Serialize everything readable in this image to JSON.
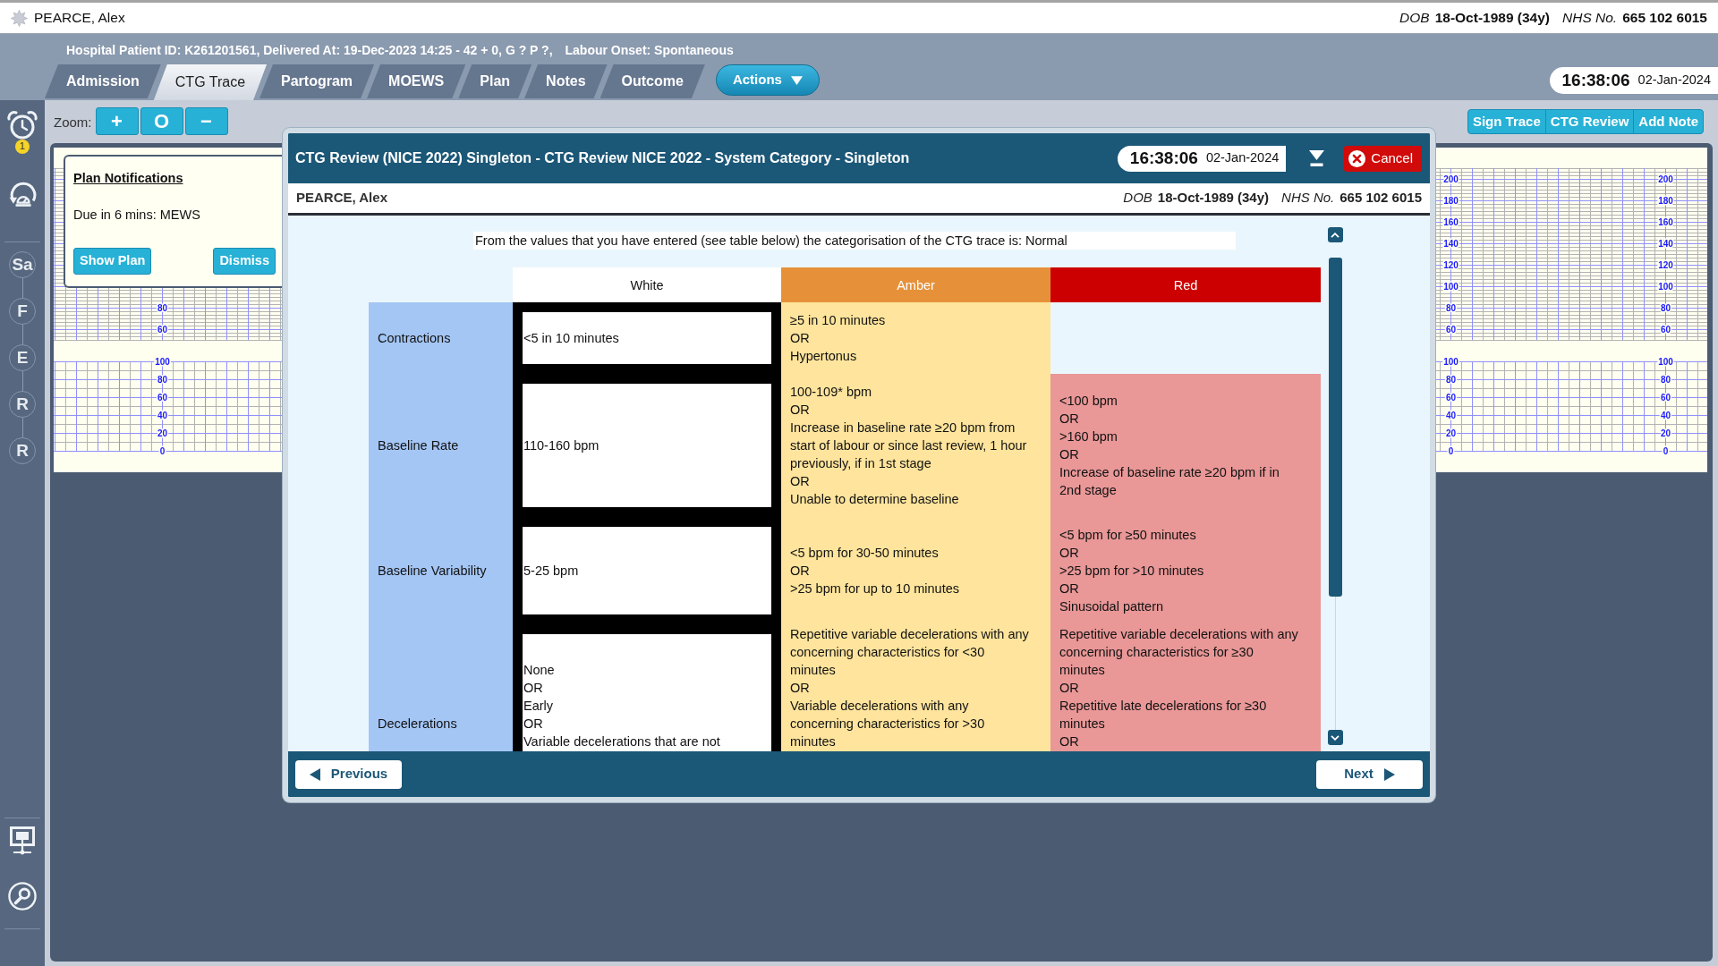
{
  "top_bar": {
    "patient_name": "PEARCE, Alex",
    "dob_label": "DOB",
    "dob": "18-Oct-1989 (34y)",
    "nhs_label": "NHS No.",
    "nhs_number": "665 102 6015"
  },
  "header": {
    "patient_info": "Hospital Patient ID: K261201561, Delivered At: 19-Dec-2023 14:25 - 42 + 0, G ? P ?,",
    "labour_onset": "Labour Onset: Spontaneous",
    "time": "16:38:06",
    "date": "02-Jan-2024"
  },
  "tabs": [
    {
      "label": "Admission",
      "selected": false
    },
    {
      "label": "CTG Trace",
      "selected": true
    },
    {
      "label": "Partogram",
      "selected": false
    },
    {
      "label": "MOEWS",
      "selected": false
    },
    {
      "label": "Plan",
      "selected": false
    },
    {
      "label": "Notes",
      "selected": false
    },
    {
      "label": "Outcome",
      "selected": false
    }
  ],
  "actions_button": {
    "label": "Actions"
  },
  "sidebar": {
    "alarm_badge": "1",
    "timeline": [
      "Sa",
      "F",
      "E",
      "R",
      "R"
    ]
  },
  "toolbar": {
    "zoom_label": "Zoom:",
    "zoom_buttons": [
      "+",
      "O",
      "−"
    ],
    "buttons": [
      "Sign Trace",
      "CTG Review",
      "Add Note"
    ]
  },
  "trace": {
    "strips": [
      {
        "axes": [
          {
            "fhr_labels": [
              "80",
              "60"
            ],
            "toco_labels": [
              "100",
              "80",
              "60",
              "40",
              "20",
              "0"
            ]
          }
        ]
      },
      {
        "axes": [
          {
            "fhr_labels": [
              "200",
              "180",
              "160",
              "140",
              "120",
              "100",
              "80",
              "60"
            ],
            "toco_labels": [
              "100",
              "80",
              "60",
              "40",
              "20",
              "0"
            ]
          },
          {
            "fhr_labels": [
              "200",
              "180",
              "160",
              "140",
              "120",
              "100",
              "80",
              "60"
            ],
            "toco_labels": [
              "100",
              "80",
              "60",
              "40",
              "20",
              "0"
            ]
          }
        ]
      }
    ]
  },
  "plan_notifications": {
    "title": "Plan Notifications",
    "message": "Due in 6 mins: MEWS",
    "buttons": [
      "Show Plan",
      "Dismiss"
    ]
  },
  "dialog": {
    "title": "CTG Review (NICE 2022) Singleton - CTG Review NICE 2022 - System Category - Singleton",
    "time": "16:38:06",
    "date": "02-Jan-2024",
    "cancel_label": "Cancel",
    "patient": {
      "name": "PEARCE, Alex",
      "dob_label": "DOB",
      "dob": "18-Oct-1989 (34y)",
      "nhs_label": "NHS No.",
      "nhs_number": "665 102 6015"
    },
    "summary": "From the values that you have entered (see table below) the categorisation of the CTG trace is: Normal",
    "columns": [
      {
        "label": "White",
        "color": "#ffffff"
      },
      {
        "label": "Amber",
        "color": "#e6913a"
      },
      {
        "label": "Red",
        "color": "#cc0000"
      }
    ],
    "rows": [
      {
        "label": "Contractions",
        "cells": [
          {
            "text": "<5 in 10 minutes",
            "selected": true
          },
          {
            "text": "≥5 in 10 minutes\nOR\nHypertonus",
            "selected": false
          }
        ]
      },
      {
        "label": "Baseline Rate",
        "cells": [
          {
            "text": "110-160 bpm",
            "selected": true
          },
          {
            "text": "100-109* bpm\nOR\nIncrease in baseline rate ≥20 bpm from\nstart of labour or since last review, 1 hour\npreviously, if in 1st stage\nOR\nUnable to determine baseline",
            "selected": false
          },
          {
            "text": "<100 bpm\nOR\n>160 bpm\nOR\nIncrease of baseline rate ≥20 bpm if in\n2nd stage",
            "selected": false
          }
        ]
      },
      {
        "label": "Baseline Variability",
        "cells": [
          {
            "text": "5-25 bpm",
            "selected": true
          },
          {
            "text": "<5 bpm for 30-50 minutes\nOR\n>25 bpm for up to 10 minutes",
            "selected": false
          },
          {
            "text": "<5 bpm for ≥50 minutes\nOR\n>25 bpm for >10 minutes\nOR\nSinusoidal pattern",
            "selected": false
          }
        ]
      },
      {
        "label": "Decelerations",
        "cells": [
          {
            "text": "None\nOR\nEarly\nOR\nVariable decelerations that are not",
            "selected": true
          },
          {
            "text": "Repetitive variable decelerations with any\nconcerning characteristics for <30\nminutes\nOR\nVariable decelerations with any\nconcerning characteristics for >30\nminutes",
            "selected": false
          },
          {
            "text": "Repetitive variable decelerations with any\nconcerning characteristics for ≥30\nminutes\nOR\nRepetitive late decelerations for ≥30\nminutes\nOR",
            "selected": false
          }
        ]
      }
    ],
    "previous_label": "Previous",
    "next_label": "Next"
  }
}
